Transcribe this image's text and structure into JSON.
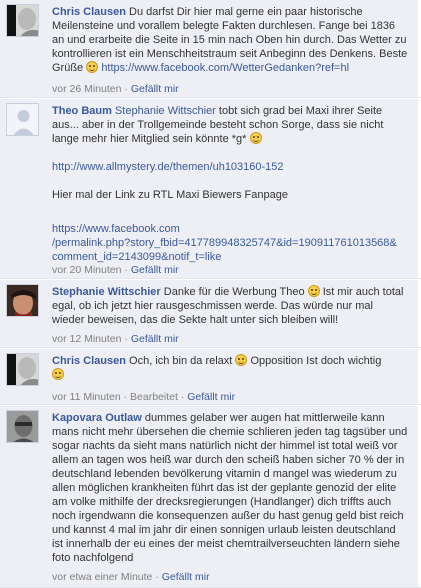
{
  "comments": [
    {
      "author": "Chris Clausen",
      "text": "Du darfst Dir hier mal gerne ein paar historische Meilensteine und vorallem belegte Fakten durchlesen. Fange bei 1836 an und erarbeite die Seite in 15 min nach Oben hin durch. Das Wetter zu kontrollieren ist ein Menschheitstraum seit Anbeginn des Denkens. Beste Grüße",
      "link": "https://www.facebook.com/WetterGedanken?ref=hl",
      "time": "vor 26 Minuten",
      "like": "Gefällt mir"
    },
    {
      "author": "Theo Baum",
      "mention": "Stephanie Wittschier",
      "text1": "tobt sich grad bei Maxi ihrer Seite aus... aber in der Trollgemeinde besteht schon Sorge, dass sie nicht lange mehr hier Mitglied sein könnte *g*",
      "link1": "http://www.allmystery.de/themen/uh103160-152",
      "text2": "Hier mal der Link zu RTL Maxi Biewers Fanpage",
      "link2a": "https://www.facebook.com",
      "link2b": "/permalink.php?story_fbid=417789948325747&id=190911761013568&",
      "link2c": "comment_id=2143099&notif_t=like",
      "time": "vor 20 Minuten",
      "like": "Gefällt mir"
    },
    {
      "author": "Stephanie Wittschier",
      "text1": "Danke für die Werbung Theo",
      "text2": "Ist mir auch total egal, ob ich jetzt hier rausgeschmissen werde. Das würde nur mal wieder beweisen, das die Sekte halt unter sich bleiben will!",
      "time": "vor 12 Minuten",
      "like": "Gefällt mir"
    },
    {
      "author": "Chris Clausen",
      "text1": "Och, ich bin da relaxt",
      "text2": "Opposition Ist doch wichtig",
      "time": "vor 11 Minuten",
      "edited": "Bearbeitet",
      "like": "Gefällt mir"
    },
    {
      "author": "Kapovara Outlaw",
      "text": "dummes gelaber wer augen hat mittlerweile kann mans nicht mehr übersehen die chemie schlieren jeden tag tagsüber und sogar nachts da sieht mans natürlich nicht der himmel ist total weiß vor allem an tagen wos heiß war durch den scheiß haben sicher 70 % der in deutschland lebenden bevölkerung vitamin d mangel was wiederum zu allen möglichen krankheiten führt das ist der geplante genozid der elite am volke mithilfe der drecksregierungen (Handlanger) dich triffts auch noch irgendwann die konsequenzen außer du hast genug geld bist reich und kannst 4 mal im jahr dir einen sonnigen urlaub leisten deutschland ist innerhalb der eu eines der meist chemtrailverseuchten ländern siehe foto nachfolgend",
      "time": "vor etwa einer Minute",
      "like": "Gefällt mir"
    }
  ]
}
